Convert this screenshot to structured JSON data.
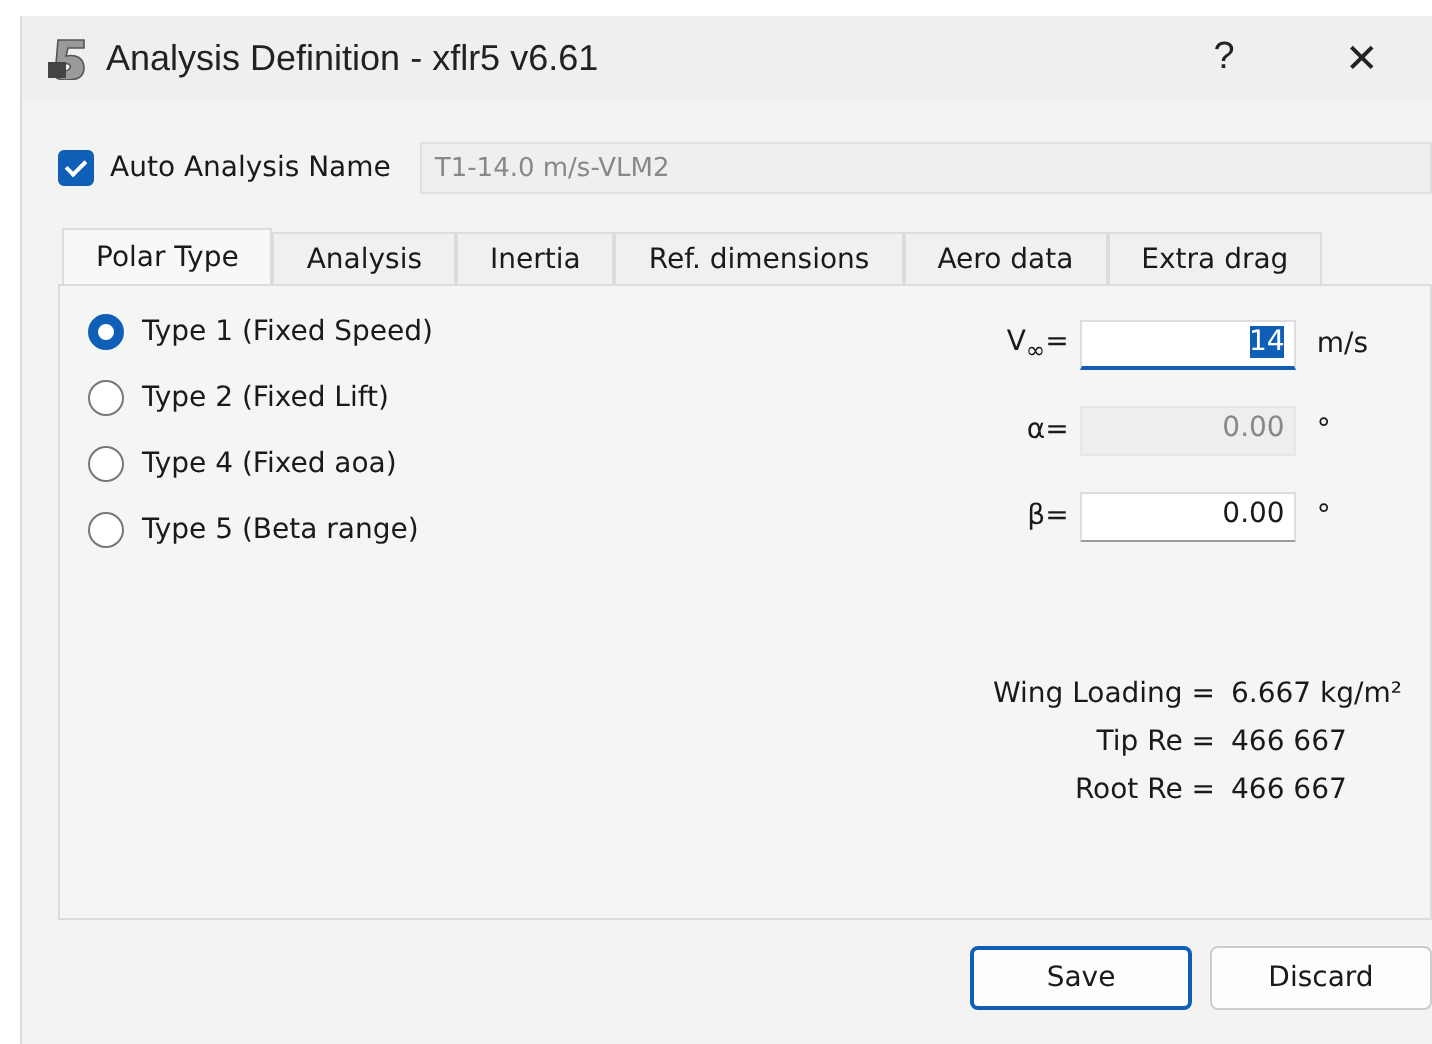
{
  "window": {
    "title": "Analysis Definition - xflr5 v6.61",
    "help": "?",
    "close": "✕"
  },
  "auto_name": {
    "label": "Auto Analysis Name",
    "checked": true,
    "value": "T1-14.0 m/s-VLM2",
    "disabled": true
  },
  "tabs": [
    {
      "label": "Polar Type",
      "selected": true
    },
    {
      "label": "Analysis",
      "selected": false
    },
    {
      "label": "Inertia",
      "selected": false
    },
    {
      "label": "Ref. dimensions",
      "selected": false
    },
    {
      "label": "Aero data",
      "selected": false
    },
    {
      "label": "Extra drag",
      "selected": false
    }
  ],
  "polar_types": [
    {
      "label": "Type 1 (Fixed Speed)",
      "selected": true
    },
    {
      "label": "Type 2 (Fixed Lift)",
      "selected": false
    },
    {
      "label": "Type 4 (Fixed aoa)",
      "selected": false
    },
    {
      "label": "Type 5 (Beta range)",
      "selected": false
    }
  ],
  "fields": [
    {
      "label": "V$_{∞}$=",
      "value": "14",
      "unit": "m/s",
      "disabled": false,
      "focused": true
    },
    {
      "label": "α=",
      "value": "0.00",
      "unit": "°",
      "disabled": true,
      "focused": false
    },
    {
      "label": "β=",
      "value": "0.00",
      "unit": "°",
      "disabled": false,
      "focused": false
    }
  ],
  "results": [
    {
      "label": "Wing Loading =",
      "value": "6.667 kg/m²"
    },
    {
      "label": "Tip Re =",
      "value": "466 667"
    },
    {
      "label": "Root Re =",
      "value": "466 667"
    }
  ],
  "buttons": [
    {
      "label": "Save",
      "default": true
    },
    {
      "label": "Discard",
      "default": false
    }
  ]
}
